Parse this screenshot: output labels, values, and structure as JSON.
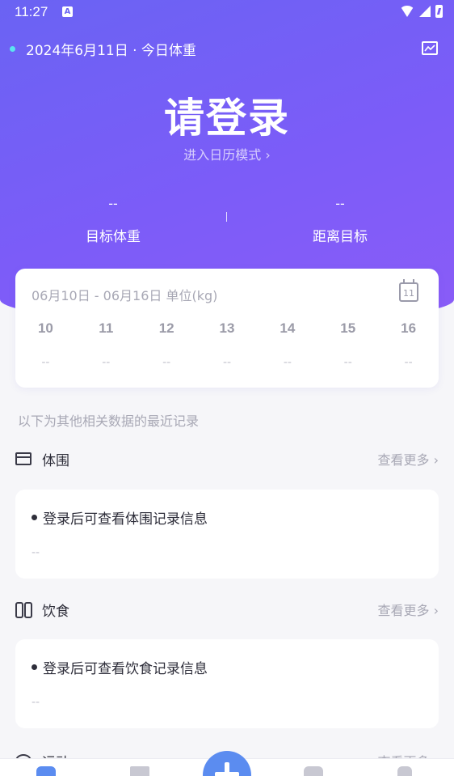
{
  "status_bar": {
    "time": "11:27",
    "app_badge": "A"
  },
  "header": {
    "date_label": "2024年6月11日 · 今日体重",
    "login_title": "请登录",
    "calendar_link": "进入日历模式 ›"
  },
  "goals": {
    "target_weight": {
      "value": "--",
      "label": "目标体重"
    },
    "distance": {
      "value": "--",
      "label": "距离目标"
    }
  },
  "week": {
    "range": "06月10日 - 06月16日 单位(kg)",
    "calendar_day": "11",
    "days": [
      {
        "num": "10",
        "weight": "--"
      },
      {
        "num": "11",
        "weight": "--"
      },
      {
        "num": "12",
        "weight": "--"
      },
      {
        "num": "13",
        "weight": "--"
      },
      {
        "num": "14",
        "weight": "--"
      },
      {
        "num": "15",
        "weight": "--"
      },
      {
        "num": "16",
        "weight": "--"
      }
    ]
  },
  "note": "以下为其他相关数据的最近记录",
  "sections": {
    "girth": {
      "title": "体围",
      "more": "查看更多 ›",
      "message": "登录后可查看体围记录信息",
      "value": "--"
    },
    "diet": {
      "title": "饮食",
      "more": "查看更多 ›",
      "message": "登录后可查看饮食记录信息",
      "value": "--"
    },
    "exercise": {
      "title": "运动",
      "more": "查看更多 ›"
    }
  },
  "colors": {
    "hero_start": "#6a63f3",
    "hero_end": "#8a5cf7",
    "accent_blue": "#5b8cf0",
    "dot_cyan": "#5be3f0"
  }
}
